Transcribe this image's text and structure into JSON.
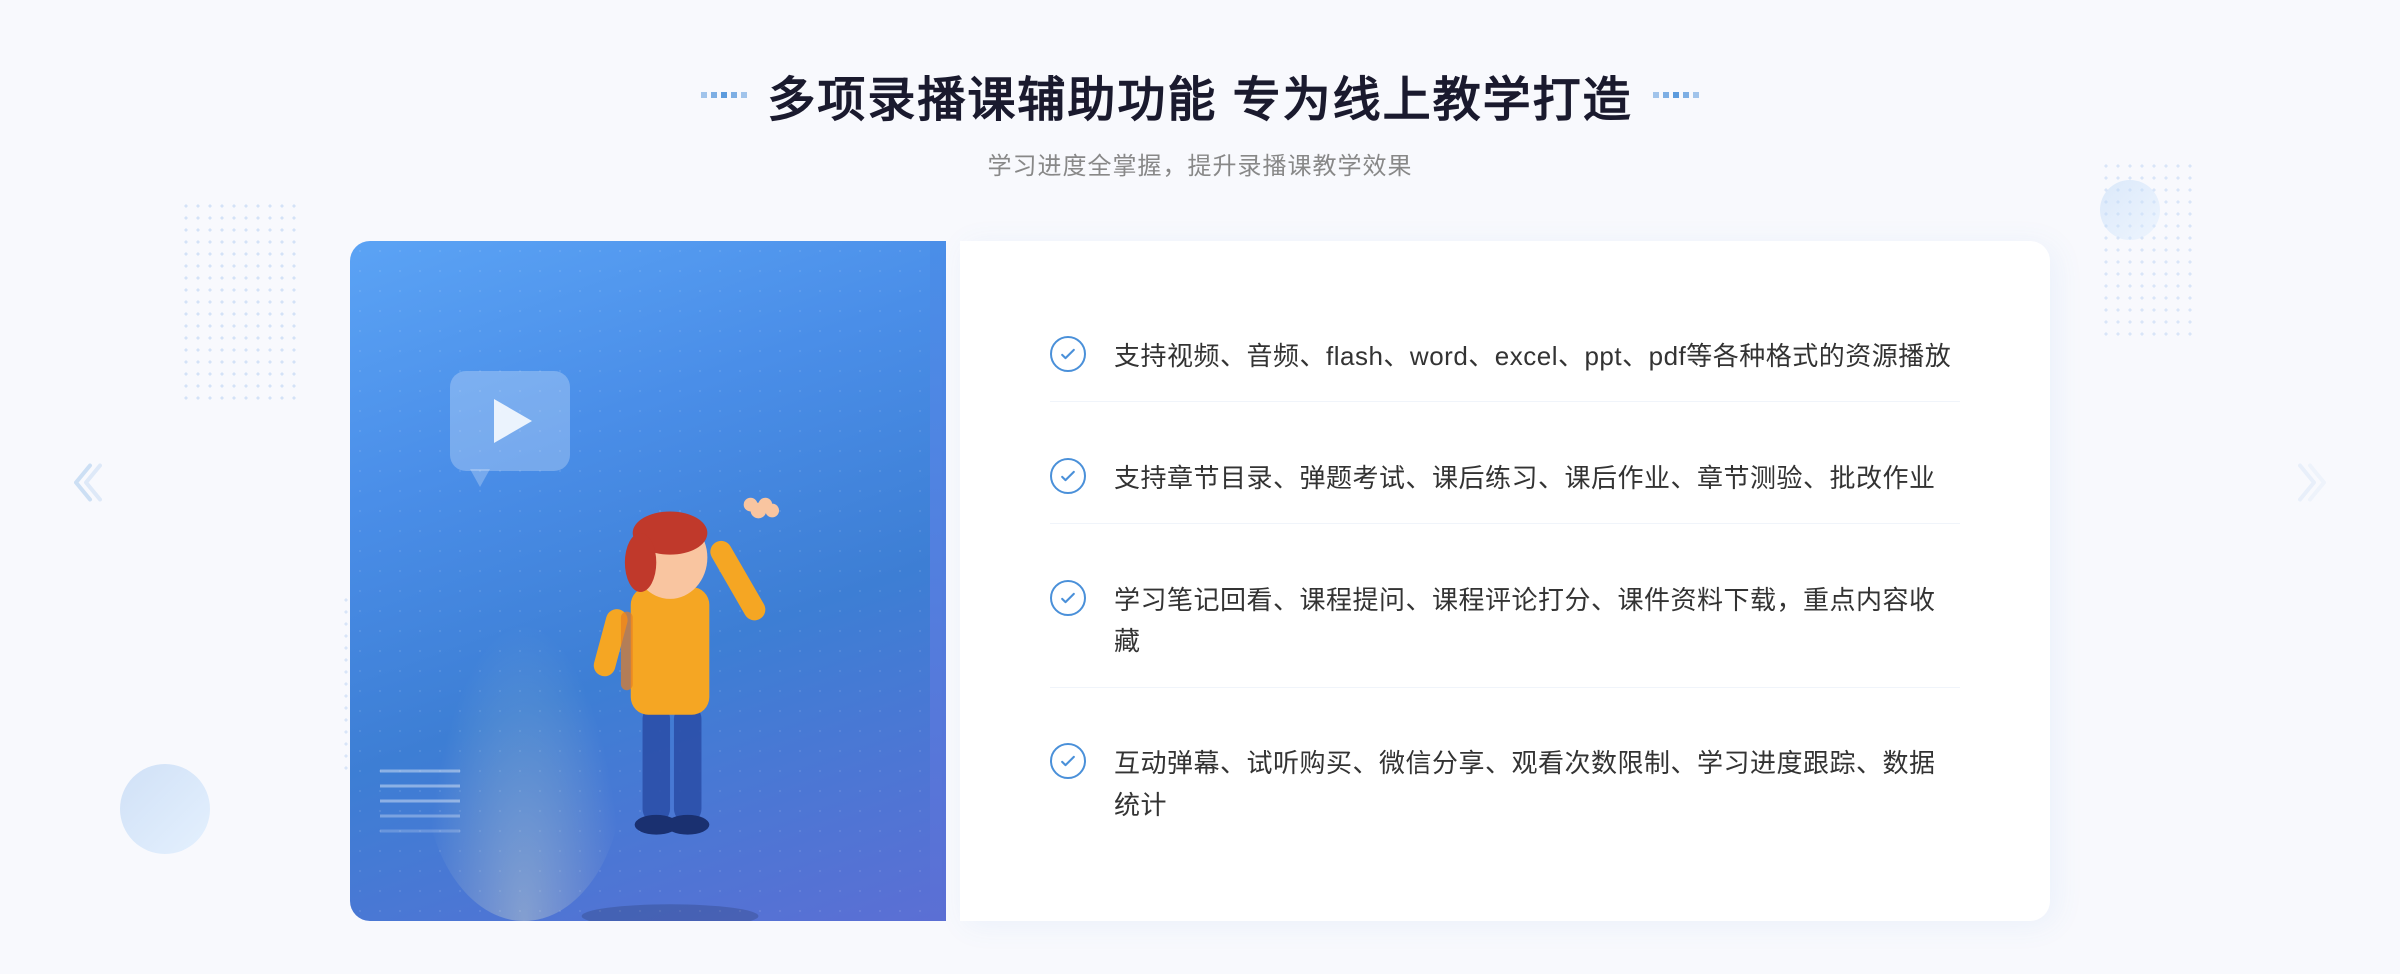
{
  "page": {
    "background": "#f5f7fd"
  },
  "header": {
    "title": "多项录播课辅助功能 专为线上教学打造",
    "subtitle": "学习进度全掌握，提升录播课教学效果",
    "decorator_dots": [
      "·",
      "·",
      "·",
      "·",
      "·"
    ]
  },
  "features": [
    {
      "id": 1,
      "text": "支持视频、音频、flash、word、excel、ppt、pdf等各种格式的资源播放"
    },
    {
      "id": 2,
      "text": "支持章节目录、弹题考试、课后练习、课后作业、章节测验、批改作业"
    },
    {
      "id": 3,
      "text": "学习笔记回看、课程提问、课程评论打分、课件资料下载，重点内容收藏"
    },
    {
      "id": 4,
      "text": "互动弹幕、试听购买、微信分享、观看次数限制、学习进度跟踪、数据统计"
    }
  ],
  "arrows": {
    "left": "»",
    "right": "»"
  }
}
